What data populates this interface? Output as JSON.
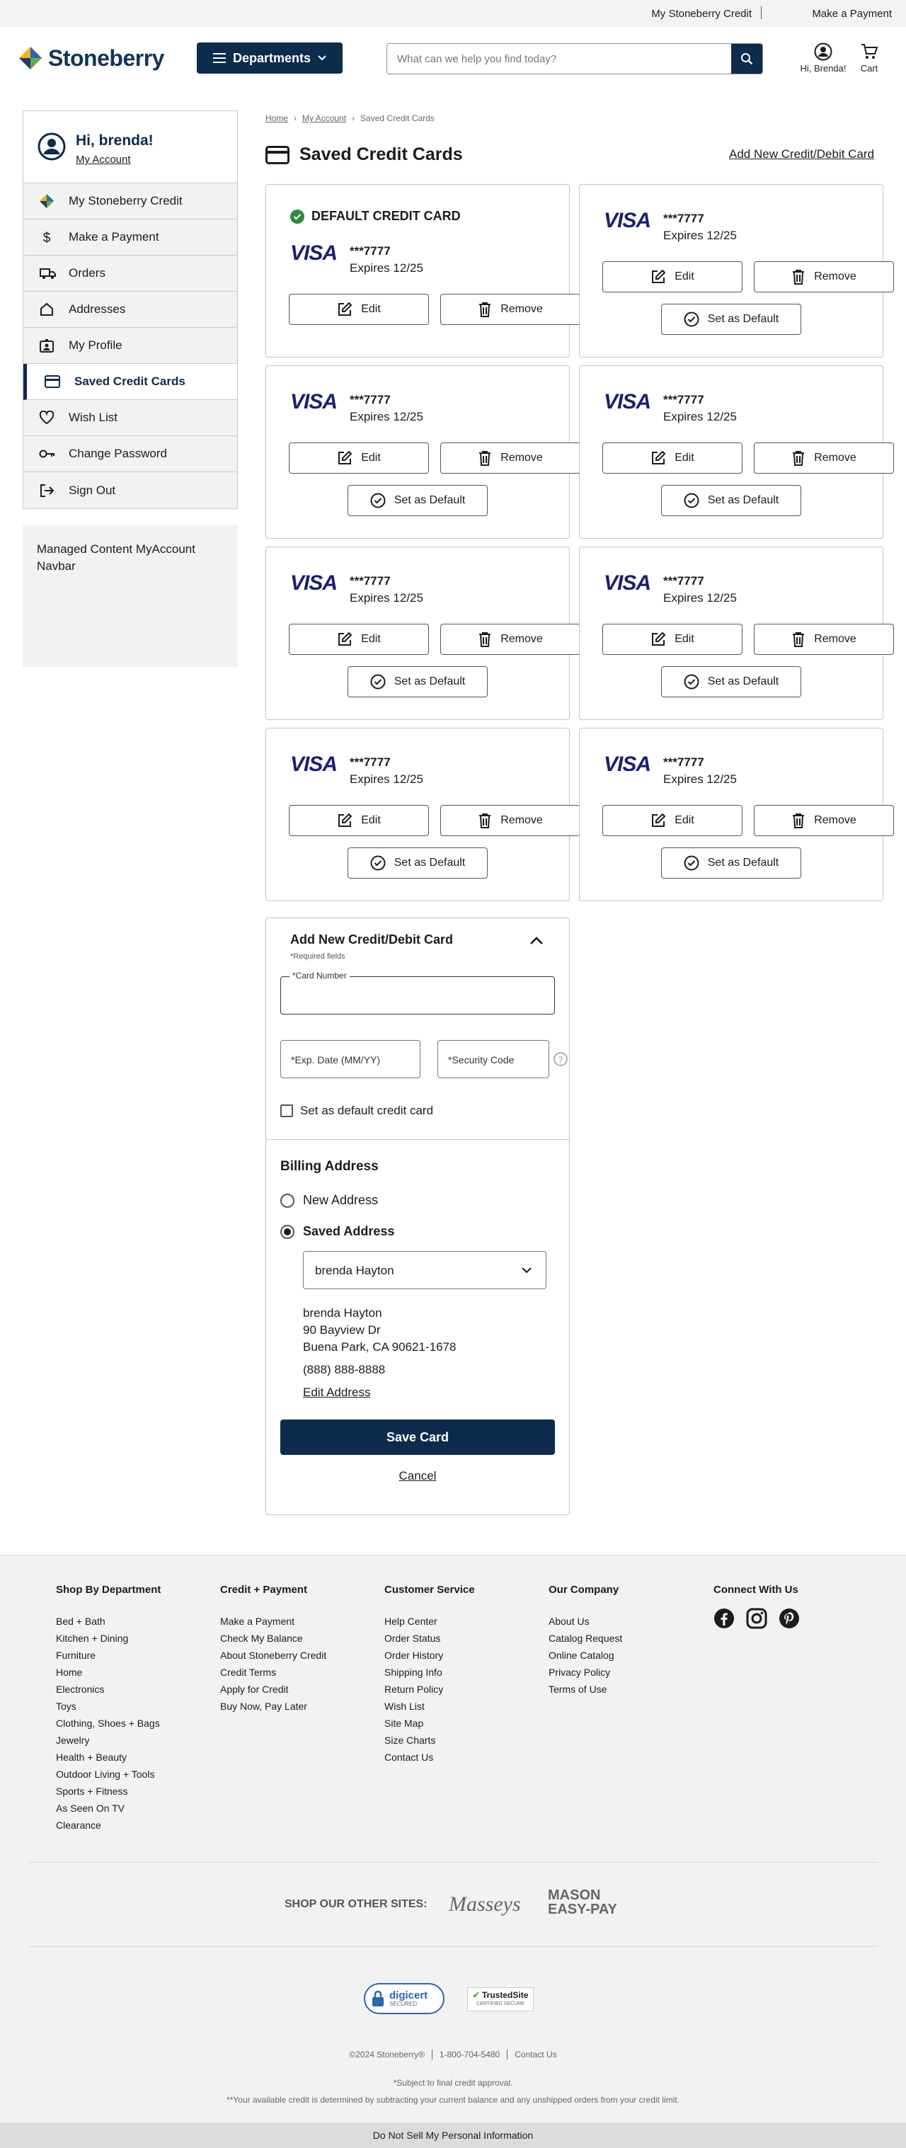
{
  "utility": {
    "credit": "My Stoneberry Credit",
    "separator": "|",
    "payment": "Make a Payment"
  },
  "header": {
    "logo": "Stoneberry",
    "departments": "Departments",
    "search_placeholder": "What can we help you find today?",
    "account_label": "Hi, Brenda!",
    "cart_label": "Cart"
  },
  "sidebar": {
    "greeting": "Hi, brenda!",
    "account_link": "My Account",
    "items": [
      {
        "label": "My Stoneberry Credit",
        "icon": "stoneberry-credit-icon"
      },
      {
        "label": "Make a Payment",
        "icon": "dollar-icon"
      },
      {
        "label": "Orders",
        "icon": "truck-icon"
      },
      {
        "label": "Addresses",
        "icon": "home-icon"
      },
      {
        "label": "My Profile",
        "icon": "profile-icon"
      },
      {
        "label": "Saved Credit Cards",
        "icon": "credit-card-icon",
        "active": true
      },
      {
        "label": "Wish List",
        "icon": "heart-icon"
      },
      {
        "label": "Change Password",
        "icon": "key-icon"
      },
      {
        "label": "Sign Out",
        "icon": "sign-out-icon"
      }
    ],
    "managed_content": "Managed Content MyAccount Navbar"
  },
  "breadcrumb": [
    "Home",
    "My Account",
    "Saved Credit Cards"
  ],
  "page": {
    "title": "Saved Credit Cards",
    "add_link": "Add New Credit/Debit Card"
  },
  "cards": {
    "default_label": "DEFAULT CREDIT CARD",
    "brand": "VISA",
    "edit": "Edit",
    "remove": "Remove",
    "set_default": "Set as Default",
    "items": [
      {
        "number": "***7777",
        "expires": "Expires 12/25",
        "default": true
      },
      {
        "number": "***7777",
        "expires": "Expires 12/25"
      },
      {
        "number": "***7777",
        "expires": "Expires 12/25"
      },
      {
        "number": "***7777",
        "expires": "Expires 12/25"
      },
      {
        "number": "***7777",
        "expires": "Expires 12/25"
      },
      {
        "number": "***7777",
        "expires": "Expires 12/25"
      },
      {
        "number": "***7777",
        "expires": "Expires 12/25"
      },
      {
        "number": "***7777",
        "expires": "Expires 12/25"
      }
    ]
  },
  "form": {
    "title": "Add New Credit/Debit Card",
    "required": "*Required fields",
    "card_number_label": "*Card Number",
    "card_number_value": "",
    "exp_label": "*Exp. Date (MM/YY)",
    "cvv_label": "*Security Code",
    "set_default_label": "Set as default credit card",
    "billing_title": "Billing Address",
    "new_address": "New Address",
    "saved_address": "Saved Address",
    "selected_address": "brenda Hayton",
    "address_lines": [
      "brenda Hayton",
      "90 Bayview Dr",
      "Buena Park, CA 90621-1678"
    ],
    "phone": "(888) 888-8888",
    "edit_address": "Edit Address",
    "save": "Save Card",
    "cancel": "Cancel"
  },
  "footer": {
    "columns": [
      {
        "title": "Shop By Department",
        "links": [
          "Bed + Bath",
          "Kitchen + Dining",
          "Furniture",
          "Home",
          "Electronics",
          "Toys",
          "Clothing, Shoes + Bags",
          "Jewelry",
          "Health + Beauty",
          "Outdoor Living + Tools",
          "Sports + Fitness",
          "As Seen On TV",
          "Clearance"
        ]
      },
      {
        "title": "Credit + Payment",
        "links": [
          "Make a Payment",
          "Check My Balance",
          "About Stoneberry Credit",
          "Credit Terms",
          "Apply for Credit",
          "Buy Now, Pay Later"
        ]
      },
      {
        "title": "Customer Service",
        "links": [
          "Help Center",
          "Order Status",
          "Order History",
          "Shipping Info",
          "Return Policy",
          "Wish List",
          "Site Map",
          "Size Charts",
          "Contact Us"
        ]
      },
      {
        "title": "Our Company",
        "links": [
          "About Us",
          "Catalog Request",
          "Online Catalog",
          "Privacy Policy",
          "Terms of Use"
        ]
      }
    ],
    "connect": "Connect With Us",
    "other_sites": "SHOP OUR OTHER SITES:",
    "masseys": "Masseys",
    "mason_line1": "MASON",
    "mason_line2": "EASY-PAY",
    "digicert": "digicert",
    "digicert_sub": "SECURED",
    "trusted": "TrustedSite",
    "trusted_sub": "CERTIFIED SECURE",
    "copyright": "©2024 Stoneberry®",
    "phone": "1-800-704-5480",
    "contact": "Contact Us",
    "note1": "*Subject to final credit approval.",
    "note2": "**Your available credit is determined by subtracting your current balance and any unshipped orders from your credit limit.",
    "dnsm": "Do Not Sell My Personal Information"
  }
}
